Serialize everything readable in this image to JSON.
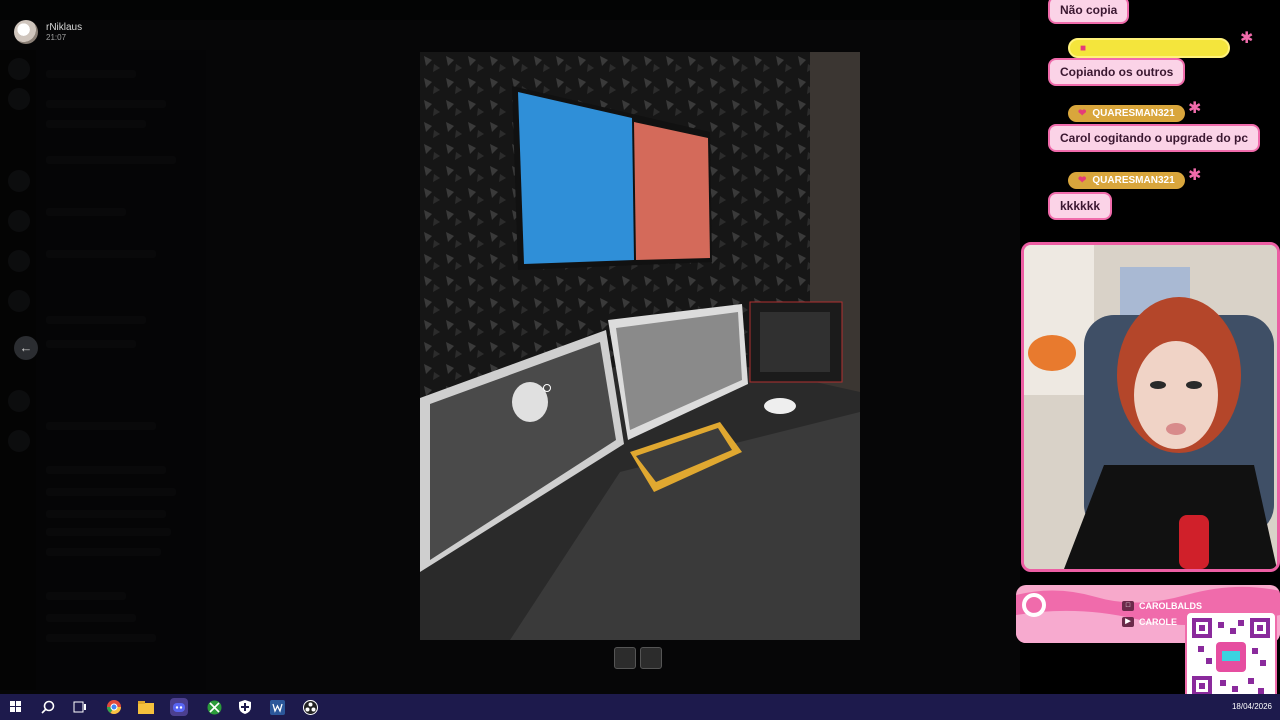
{
  "discord": {
    "user_name": "rNiklaus",
    "user_time": "21:07",
    "back_icon": "arrow-left-icon"
  },
  "chat_messages": [
    {
      "text": "Não copia"
    },
    {
      "badge": "",
      "text": "Copiando os outros"
    },
    {
      "badge": "QUARESMAN321",
      "text": "Carol cogitando o upgrade do pc"
    },
    {
      "badge": "QUARESMAN321",
      "text": "kkkkkk"
    }
  ],
  "socials": [
    {
      "icon": "instagram-x-icon",
      "handle": "CAROLBALDS"
    },
    {
      "icon": "youtube-icon",
      "handle": "CAROLE"
    }
  ],
  "taskbar": {
    "date": "18/04/2026",
    "icons": [
      "windows-start-icon",
      "search-icon",
      "task-view-icon",
      "chrome-icon",
      "file-explorer-icon",
      "discord-icon",
      "xbox-icon",
      "security-icon",
      "word-icon",
      "obs-icon"
    ]
  },
  "colors": {
    "taskbar": "#1d1a4c",
    "overlay_pink": "#f06bab",
    "badge_yellow": "#f4e53c",
    "badge_gold": "#d9a63c"
  }
}
